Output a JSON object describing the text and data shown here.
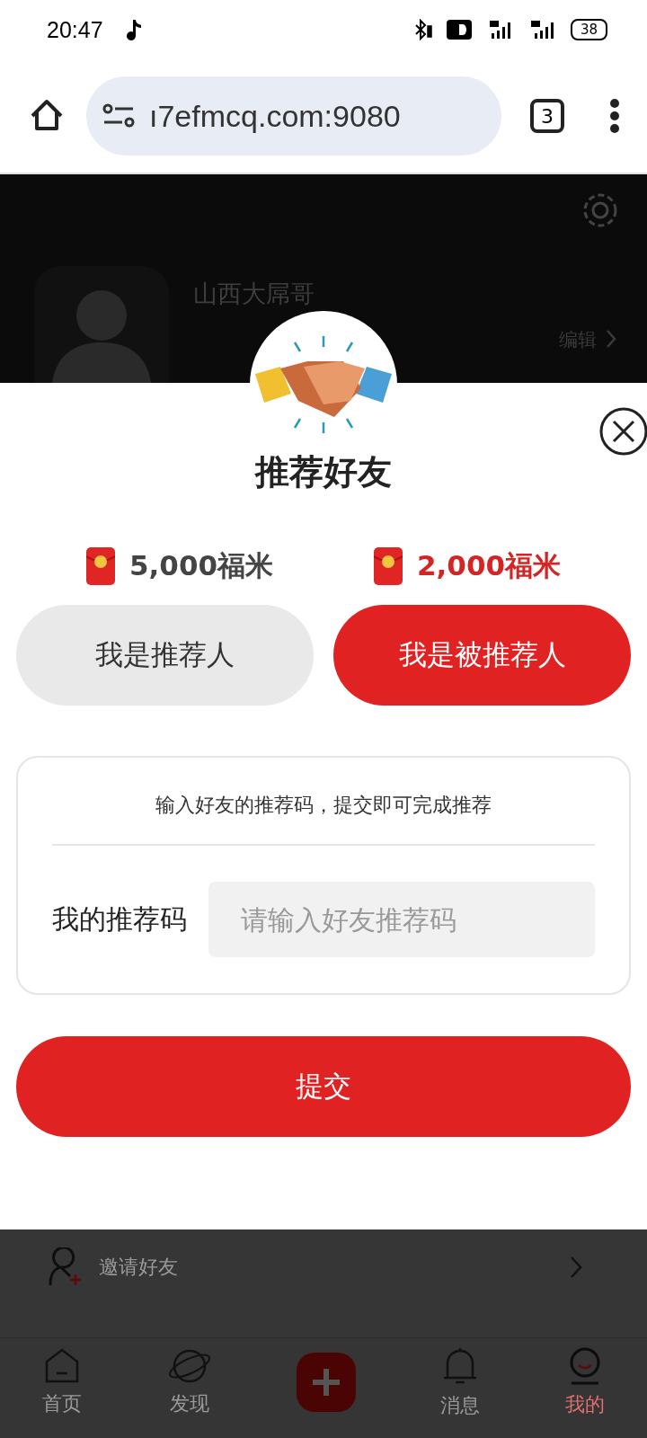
{
  "status_bar": {
    "time": "20:47",
    "battery": "38"
  },
  "browser": {
    "url": "ı7efmcq.com:9080",
    "tab_count": "3"
  },
  "profile": {
    "name": "山西大屌哥",
    "edit_label": "编辑"
  },
  "modal": {
    "title": "推荐好友",
    "rewards": [
      {
        "amount": "5,000福米",
        "selected": false
      },
      {
        "amount": "2,000福米",
        "selected": true
      }
    ],
    "roles": [
      {
        "label": "我是推荐人",
        "selected": false
      },
      {
        "label": "我是被推荐人",
        "selected": true
      }
    ],
    "card": {
      "hint": "输入好友的推荐码，提交即可完成推荐",
      "field_label": "我的推荐码",
      "placeholder": "请输入好友推荐码"
    },
    "submit": "提交"
  },
  "menu_items": [
    {
      "label": "邀请好友"
    }
  ],
  "tab_bar": [
    {
      "label": "首页",
      "kind": "home",
      "selected": false
    },
    {
      "label": "发现",
      "kind": "planet",
      "selected": false
    },
    {
      "kind": "add",
      "selected": false
    },
    {
      "label": "消息",
      "kind": "bell",
      "selected": false
    },
    {
      "label": "我的",
      "kind": "face",
      "selected": true
    }
  ]
}
